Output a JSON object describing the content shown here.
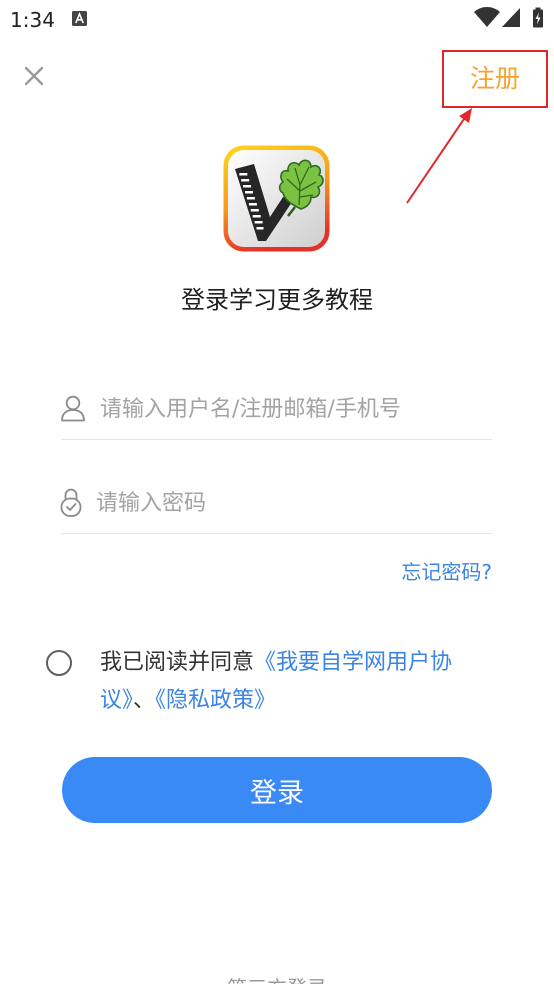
{
  "status_bar": {
    "time": "1:34",
    "icons": [
      "a-notification-icon",
      "wifi-icon",
      "signal-icon",
      "battery-charging-icon"
    ]
  },
  "header": {
    "close_icon": "close-icon",
    "register_label": "注册"
  },
  "app": {
    "logo_icon": "app-logo",
    "title": "登录学习更多教程"
  },
  "form": {
    "username": {
      "icon": "user-icon",
      "placeholder": "请输入用户名/注册邮箱/手机号",
      "value": ""
    },
    "password": {
      "icon": "lock-icon",
      "placeholder": "请输入密码",
      "value": ""
    },
    "forgot_password": "忘记密码?"
  },
  "agreement": {
    "checked": false,
    "prefix": "我已阅读并同意",
    "user_agreement": "《我要自学网用户协议》",
    "separator": "、",
    "privacy_policy": "《隐私政策》"
  },
  "login_button": {
    "label": "登录"
  },
  "third_party_login": {
    "label": "第三方登录"
  },
  "colors": {
    "primary_button": "#3a8af6",
    "link": "#3a84e6",
    "register": "#f5a230",
    "annotation": "#e3262c",
    "placeholder": "#a3a3a3"
  }
}
